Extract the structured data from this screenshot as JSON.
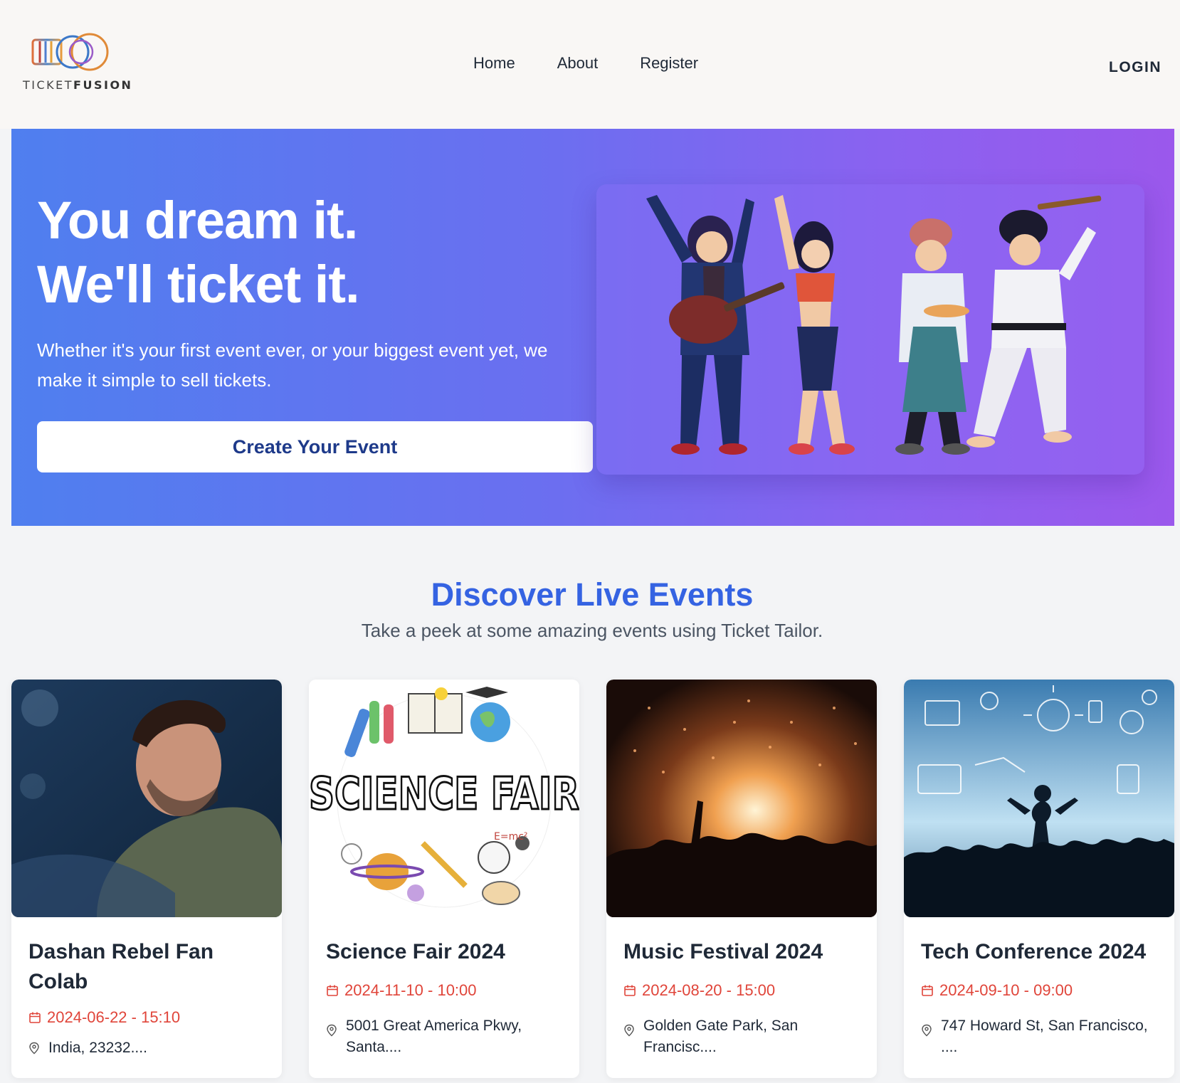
{
  "brand": {
    "name_light": "TICKET",
    "name_bold": "FUSION"
  },
  "nav": {
    "items": [
      "Home",
      "About",
      "Register"
    ],
    "login": "LOGIN"
  },
  "hero": {
    "title_line1": "You dream it.",
    "title_line2": "We'll ticket it.",
    "subtitle": "Whether it's your first event ever, or your biggest event yet, we make it simple to sell tickets.",
    "cta": "Create Your Event"
  },
  "discover": {
    "title": "Discover Live Events",
    "subtitle": "Take a peek at some amazing events using Ticket Tailor."
  },
  "events": [
    {
      "title": "Dashan Rebel Fan Colab",
      "datetime": "2024-06-22 - 15:10",
      "location": "India, 23232...."
    },
    {
      "title": "Science Fair 2024",
      "datetime": "2024-11-10 - 10:00",
      "location": "5001 Great America Pkwy, Santa...."
    },
    {
      "title": "Music Festival 2024",
      "datetime": "2024-08-20 - 15:00",
      "location": "Golden Gate Park, San Francisc...."
    },
    {
      "title": "Tech Conference 2024",
      "datetime": "2024-09-10 - 09:00",
      "location": "747 Howard St, San Francisco, ...."
    }
  ],
  "art": {
    "science_banner": "SCIENCE FAIR"
  },
  "colors": {
    "accent": "#3563e2",
    "date": "#e0453a",
    "cta_text": "#1e3a8a"
  }
}
